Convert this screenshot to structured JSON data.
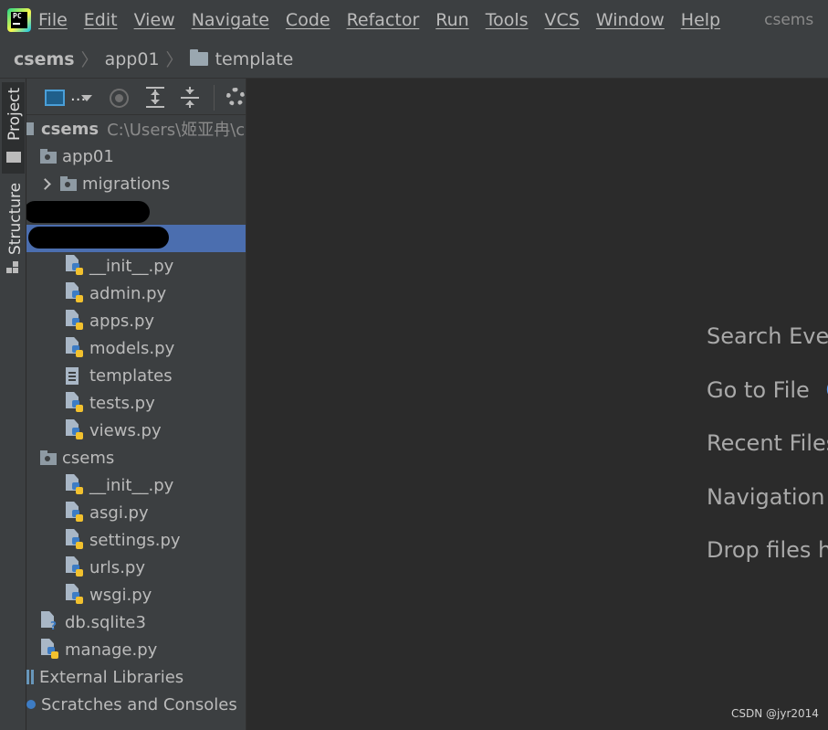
{
  "menu": {
    "logo_text": "PC",
    "items": [
      "File",
      "Edit",
      "View",
      "Navigate",
      "Code",
      "Refactor",
      "Run",
      "Tools",
      "VCS",
      "Window",
      "Help"
    ],
    "project_title": "csems"
  },
  "breadcrumb": {
    "items": [
      "csems",
      "app01",
      "template"
    ]
  },
  "toolstrip": {
    "project_tab": "Project",
    "structure_tab": "Structure"
  },
  "panel": {
    "toolbar": {
      "view_dots": "..."
    },
    "tree": {
      "root_name": "csems",
      "root_path": "C:\\Users\\姬亚冉\\cse",
      "app01": "app01",
      "migrations": "migrations",
      "app01_files": [
        "__init__.py",
        "admin.py",
        "apps.py",
        "models.py",
        "templates",
        "tests.py",
        "views.py"
      ],
      "csems_pkg": "csems",
      "csems_files": [
        "__init__.py",
        "asgi.py",
        "settings.py",
        "urls.py",
        "wsgi.py"
      ],
      "db": "db.sqlite3",
      "manage": "manage.py",
      "external": "External Libraries",
      "scratches": "Scratches and Consoles"
    }
  },
  "editor": {
    "hints": [
      {
        "text": "Search Ever",
        "key": ""
      },
      {
        "text": "Go to File",
        "key": "C"
      },
      {
        "text": "Recent Files",
        "key": ""
      },
      {
        "text": "Navigation",
        "key": ""
      },
      {
        "text": "Drop files he",
        "key": ""
      }
    ],
    "watermark": "CSDN @jyr2014"
  },
  "colors": {
    "background": "#2b2b2b",
    "panel": "#3c3f41",
    "selection": "#4b6eaf",
    "accent_key": "#589df6"
  }
}
